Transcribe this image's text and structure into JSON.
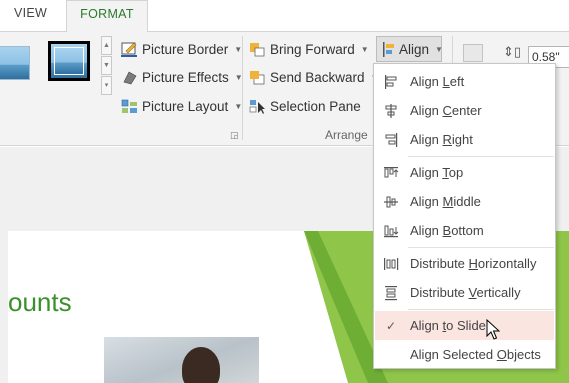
{
  "tabs": [
    {
      "label": "VIEW",
      "active": false
    },
    {
      "label": "FORMAT",
      "active": true
    }
  ],
  "ribbon": {
    "picture_styles": {
      "picture_border": "Picture Border",
      "picture_effects": "Picture Effects",
      "picture_layout": "Picture Layout"
    },
    "arrange": {
      "bring_forward": "Bring Forward",
      "send_backward": "Send Backward",
      "selection_pane": "Selection Pane",
      "align": "Align",
      "group_label": "Arrange"
    },
    "size": {
      "height_value": "0.58\""
    }
  },
  "align_menu": {
    "items": [
      {
        "pre": "Align ",
        "u": "L",
        "post": "eft",
        "icon": "align-left-icon"
      },
      {
        "pre": "Align ",
        "u": "C",
        "post": "enter",
        "icon": "align-center-icon"
      },
      {
        "pre": "Align ",
        "u": "R",
        "post": "ight",
        "icon": "align-right-icon"
      },
      {
        "pre": "Align ",
        "u": "T",
        "post": "op",
        "icon": "align-top-icon"
      },
      {
        "pre": "Align ",
        "u": "M",
        "post": "iddle",
        "icon": "align-middle-icon"
      },
      {
        "pre": "Align ",
        "u": "B",
        "post": "ottom",
        "icon": "align-bottom-icon"
      },
      {
        "pre": "Distribute ",
        "u": "H",
        "post": "orizontally",
        "icon": "distribute-horizontally-icon"
      },
      {
        "pre": "Distribute ",
        "u": "V",
        "post": "ertically",
        "icon": "distribute-vertically-icon"
      },
      {
        "pre": "Align ",
        "u": "t",
        "post": "o Slide",
        "icon": "checkmark-icon",
        "checked": true
      },
      {
        "pre": "Align Selected ",
        "u": "O",
        "post": "bjects",
        "icon": ""
      }
    ]
  },
  "slide": {
    "title_fragment": "ounts"
  },
  "colors": {
    "accent_green": "#2a7a2a",
    "title_green": "#3b8f2c",
    "hover_bg": "#fbe5e0"
  }
}
